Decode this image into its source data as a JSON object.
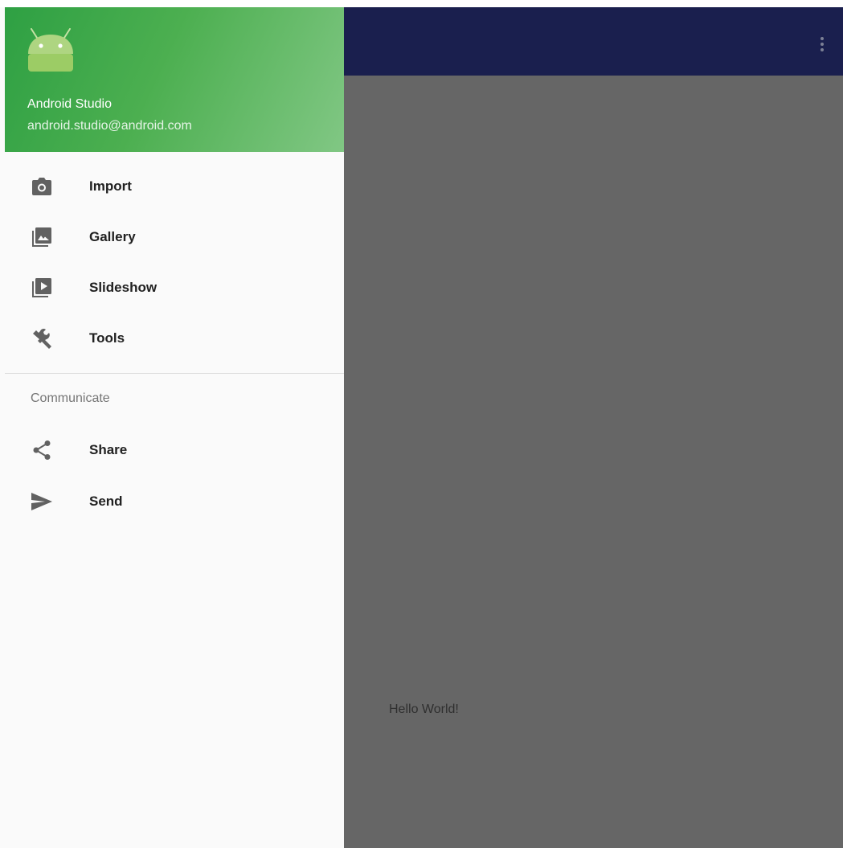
{
  "app_bar": {
    "background": "#1a1f4e",
    "overflow_icon": "more-vert-icon"
  },
  "content": {
    "hello_text": "Hello World!"
  },
  "drawer": {
    "header": {
      "logo_icon": "android-icon",
      "name": "Android Studio",
      "email": "android.studio@android.com",
      "accent_color": "#4caf50"
    },
    "items": [
      {
        "label": "Import",
        "icon": "camera-icon"
      },
      {
        "label": "Gallery",
        "icon": "gallery-icon"
      },
      {
        "label": "Slideshow",
        "icon": "slideshow-icon"
      },
      {
        "label": "Tools",
        "icon": "wrench-icon"
      }
    ],
    "section": {
      "title": "Communicate",
      "items": [
        {
          "label": "Share",
          "icon": "share-icon"
        },
        {
          "label": "Send",
          "icon": "send-icon"
        }
      ]
    }
  }
}
